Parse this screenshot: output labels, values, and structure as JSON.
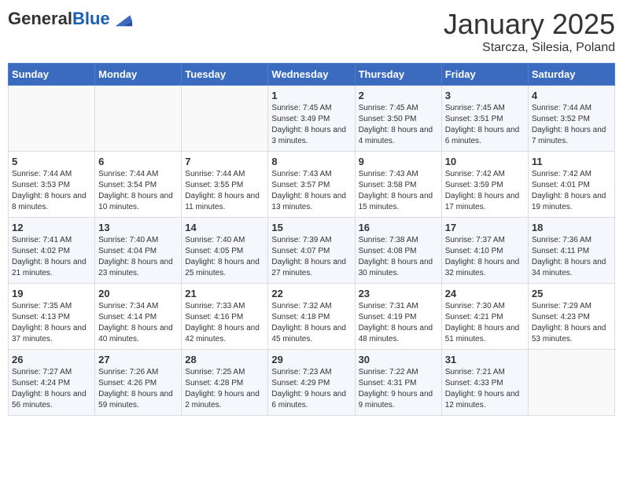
{
  "header": {
    "logo_general": "General",
    "logo_blue": "Blue",
    "month": "January 2025",
    "location": "Starcza, Silesia, Poland"
  },
  "days_of_week": [
    "Sunday",
    "Monday",
    "Tuesday",
    "Wednesday",
    "Thursday",
    "Friday",
    "Saturday"
  ],
  "weeks": [
    [
      {
        "num": "",
        "info": ""
      },
      {
        "num": "",
        "info": ""
      },
      {
        "num": "",
        "info": ""
      },
      {
        "num": "1",
        "info": "Sunrise: 7:45 AM\nSunset: 3:49 PM\nDaylight: 8 hours and 3 minutes."
      },
      {
        "num": "2",
        "info": "Sunrise: 7:45 AM\nSunset: 3:50 PM\nDaylight: 8 hours and 4 minutes."
      },
      {
        "num": "3",
        "info": "Sunrise: 7:45 AM\nSunset: 3:51 PM\nDaylight: 8 hours and 6 minutes."
      },
      {
        "num": "4",
        "info": "Sunrise: 7:44 AM\nSunset: 3:52 PM\nDaylight: 8 hours and 7 minutes."
      }
    ],
    [
      {
        "num": "5",
        "info": "Sunrise: 7:44 AM\nSunset: 3:53 PM\nDaylight: 8 hours and 8 minutes."
      },
      {
        "num": "6",
        "info": "Sunrise: 7:44 AM\nSunset: 3:54 PM\nDaylight: 8 hours and 10 minutes."
      },
      {
        "num": "7",
        "info": "Sunrise: 7:44 AM\nSunset: 3:55 PM\nDaylight: 8 hours and 11 minutes."
      },
      {
        "num": "8",
        "info": "Sunrise: 7:43 AM\nSunset: 3:57 PM\nDaylight: 8 hours and 13 minutes."
      },
      {
        "num": "9",
        "info": "Sunrise: 7:43 AM\nSunset: 3:58 PM\nDaylight: 8 hours and 15 minutes."
      },
      {
        "num": "10",
        "info": "Sunrise: 7:42 AM\nSunset: 3:59 PM\nDaylight: 8 hours and 17 minutes."
      },
      {
        "num": "11",
        "info": "Sunrise: 7:42 AM\nSunset: 4:01 PM\nDaylight: 8 hours and 19 minutes."
      }
    ],
    [
      {
        "num": "12",
        "info": "Sunrise: 7:41 AM\nSunset: 4:02 PM\nDaylight: 8 hours and 21 minutes."
      },
      {
        "num": "13",
        "info": "Sunrise: 7:40 AM\nSunset: 4:04 PM\nDaylight: 8 hours and 23 minutes."
      },
      {
        "num": "14",
        "info": "Sunrise: 7:40 AM\nSunset: 4:05 PM\nDaylight: 8 hours and 25 minutes."
      },
      {
        "num": "15",
        "info": "Sunrise: 7:39 AM\nSunset: 4:07 PM\nDaylight: 8 hours and 27 minutes."
      },
      {
        "num": "16",
        "info": "Sunrise: 7:38 AM\nSunset: 4:08 PM\nDaylight: 8 hours and 30 minutes."
      },
      {
        "num": "17",
        "info": "Sunrise: 7:37 AM\nSunset: 4:10 PM\nDaylight: 8 hours and 32 minutes."
      },
      {
        "num": "18",
        "info": "Sunrise: 7:36 AM\nSunset: 4:11 PM\nDaylight: 8 hours and 34 minutes."
      }
    ],
    [
      {
        "num": "19",
        "info": "Sunrise: 7:35 AM\nSunset: 4:13 PM\nDaylight: 8 hours and 37 minutes."
      },
      {
        "num": "20",
        "info": "Sunrise: 7:34 AM\nSunset: 4:14 PM\nDaylight: 8 hours and 40 minutes."
      },
      {
        "num": "21",
        "info": "Sunrise: 7:33 AM\nSunset: 4:16 PM\nDaylight: 8 hours and 42 minutes."
      },
      {
        "num": "22",
        "info": "Sunrise: 7:32 AM\nSunset: 4:18 PM\nDaylight: 8 hours and 45 minutes."
      },
      {
        "num": "23",
        "info": "Sunrise: 7:31 AM\nSunset: 4:19 PM\nDaylight: 8 hours and 48 minutes."
      },
      {
        "num": "24",
        "info": "Sunrise: 7:30 AM\nSunset: 4:21 PM\nDaylight: 8 hours and 51 minutes."
      },
      {
        "num": "25",
        "info": "Sunrise: 7:29 AM\nSunset: 4:23 PM\nDaylight: 8 hours and 53 minutes."
      }
    ],
    [
      {
        "num": "26",
        "info": "Sunrise: 7:27 AM\nSunset: 4:24 PM\nDaylight: 8 hours and 56 minutes."
      },
      {
        "num": "27",
        "info": "Sunrise: 7:26 AM\nSunset: 4:26 PM\nDaylight: 8 hours and 59 minutes."
      },
      {
        "num": "28",
        "info": "Sunrise: 7:25 AM\nSunset: 4:28 PM\nDaylight: 9 hours and 2 minutes."
      },
      {
        "num": "29",
        "info": "Sunrise: 7:23 AM\nSunset: 4:29 PM\nDaylight: 9 hours and 6 minutes."
      },
      {
        "num": "30",
        "info": "Sunrise: 7:22 AM\nSunset: 4:31 PM\nDaylight: 9 hours and 9 minutes."
      },
      {
        "num": "31",
        "info": "Sunrise: 7:21 AM\nSunset: 4:33 PM\nDaylight: 9 hours and 12 minutes."
      },
      {
        "num": "",
        "info": ""
      }
    ]
  ]
}
